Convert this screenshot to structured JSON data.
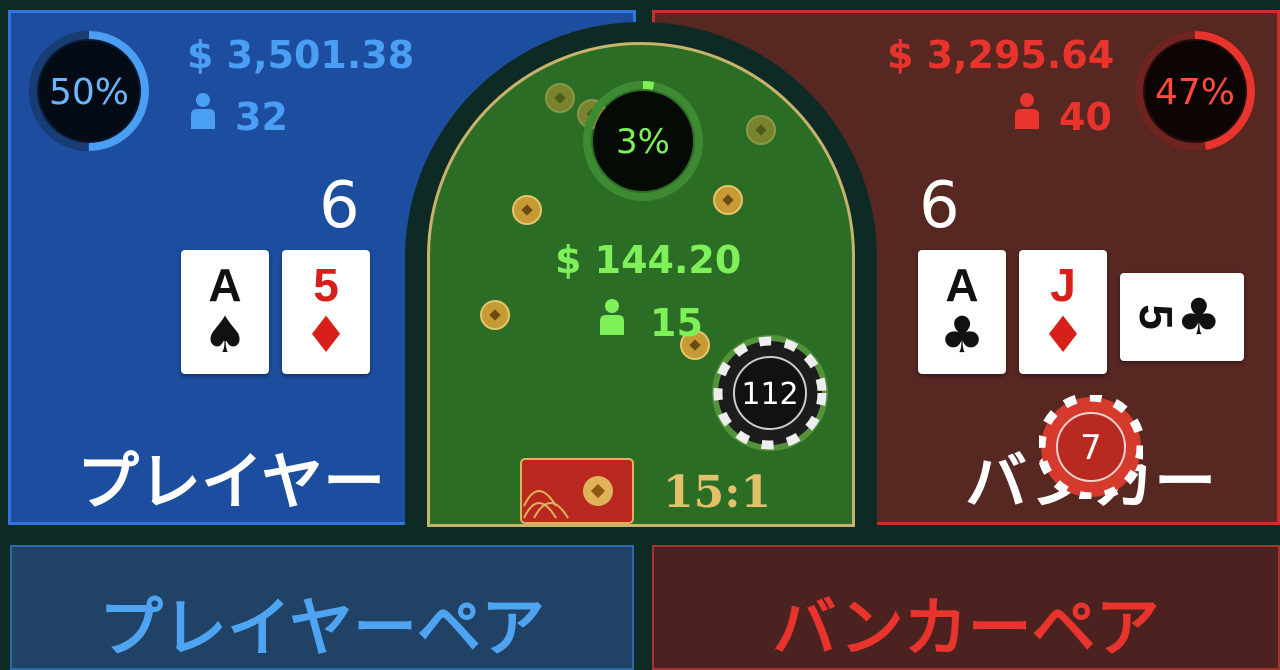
{
  "player": {
    "percent": "50%",
    "percent_value": 50,
    "money": "$ 3,501.38",
    "count": "32",
    "score": "6",
    "label": "プレイヤー",
    "cards": [
      {
        "rank": "A",
        "suit": "♠",
        "color": "black"
      },
      {
        "rank": "5",
        "suit": "♦",
        "color": "red"
      }
    ]
  },
  "tie": {
    "percent": "3%",
    "percent_value": 3,
    "money": "$ 144.20",
    "count": "15",
    "payout": "15:1",
    "chip": "112"
  },
  "banker": {
    "percent": "47%",
    "percent_value": 47,
    "money": "$ 3,295.64",
    "count": "40",
    "score": "6",
    "label": "バンカー",
    "chip": "7",
    "cards": [
      {
        "rank": "A",
        "suit": "♣",
        "color": "black"
      },
      {
        "rank": "J",
        "suit": "♦",
        "color": "red"
      },
      {
        "rank": "5",
        "suit": "♣",
        "color": "black"
      }
    ]
  },
  "player_pair": {
    "label": "プレイヤーペア"
  },
  "banker_pair": {
    "label": "バンカーペア"
  },
  "colors": {
    "player": "#4a9ff5",
    "banker": "#e8342c",
    "tie": "#7ef05a"
  }
}
